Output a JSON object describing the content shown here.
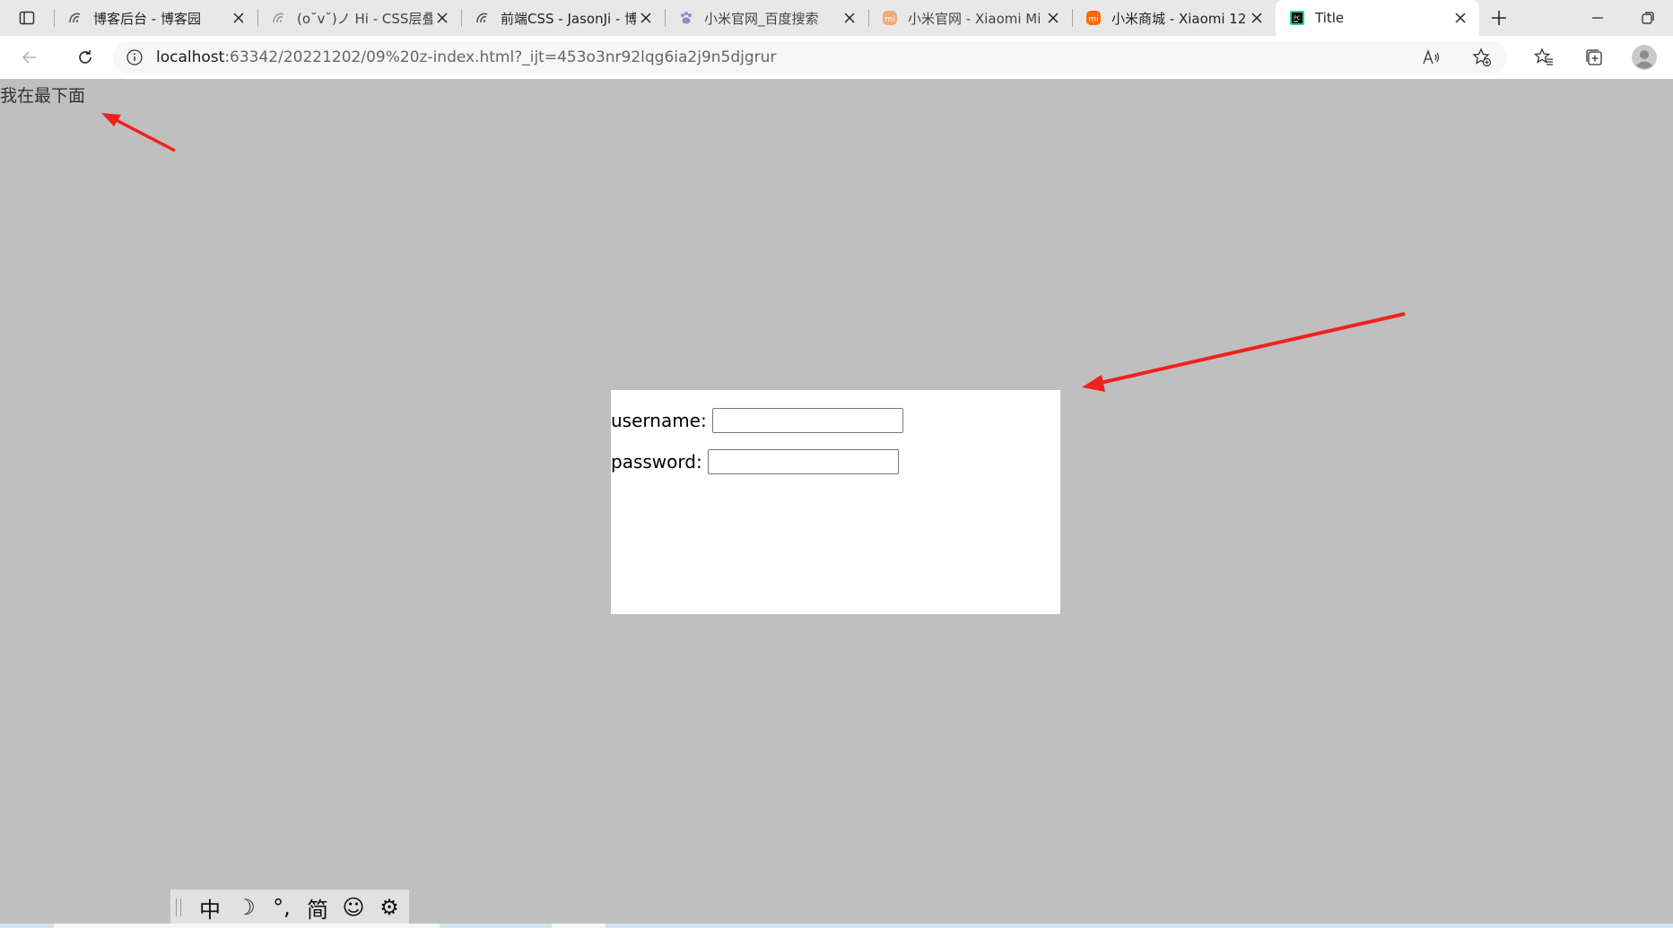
{
  "browser": {
    "tabs": [
      {
        "title": "博客后台 - 博客园",
        "icon": "cnblogs-icon"
      },
      {
        "title": "(o˘v˘)ノ Hi - CSS层叠",
        "icon": "cnblogs-icon"
      },
      {
        "title": "前端CSS - JasonJi - 博客园",
        "icon": "cnblogs-icon"
      },
      {
        "title": "小米官网_百度搜索",
        "icon": "baidu-icon"
      },
      {
        "title": "小米官网 - Xiaomi Mi",
        "icon": "mi-icon"
      },
      {
        "title": "小米商城 - Xiaomi 12",
        "icon": "mi-icon"
      },
      {
        "title": "Title",
        "icon": "pycharm-icon",
        "active": true
      }
    ],
    "address": {
      "host": "localhost",
      "rest": ":63342/20221202/09%20z-index.html?_ijt=453o3nr92lqg6ia2j9n5djgrur"
    }
  },
  "page": {
    "bottom_text": "我在最下面",
    "login": {
      "username_label": "username:",
      "password_label": "password:",
      "username_value": "",
      "password_value": ""
    }
  },
  "ime": {
    "items": [
      "中",
      "☽",
      "°,",
      "简",
      "☺",
      "⚙"
    ]
  },
  "colors": {
    "page_bg": "#bfbfbf",
    "arrow": "#f2211b",
    "mi_orange": "#ff6700"
  }
}
